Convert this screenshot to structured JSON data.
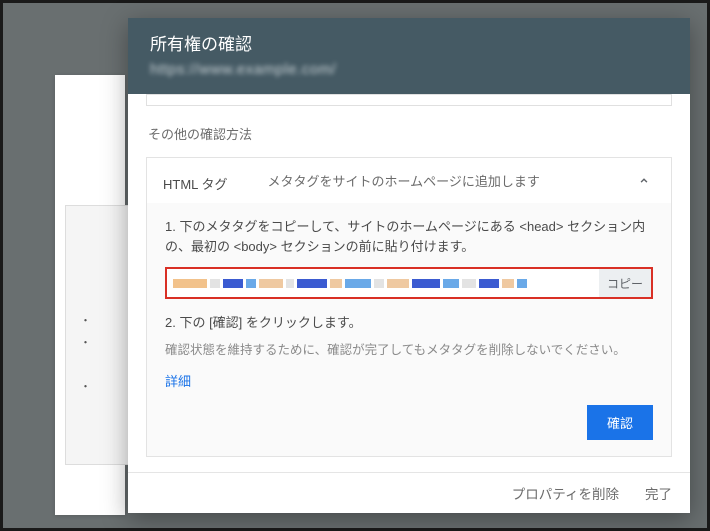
{
  "dialog": {
    "title": "所有権の確認",
    "subtitle": "https://www.example.com/"
  },
  "other_methods_label": "その他の確認方法",
  "method": {
    "name": "HTML タグ",
    "description": "メタタグをサイトのホームページに追加します"
  },
  "steps": {
    "step1": "1. 下のメタタグをコピーして、サイトのホームページにある <head> セクション内の、最初の <body> セクションの前に貼り付けます。",
    "copy_label": "コピー",
    "step2": "2. 下の [確認] をクリックします。",
    "note": "確認状態を維持するために、確認が完了してもメタタグを削除しないでください。",
    "details": "詳細",
    "verify": "確認"
  },
  "footer": {
    "remove": "プロパティを削除",
    "done": "完了"
  }
}
